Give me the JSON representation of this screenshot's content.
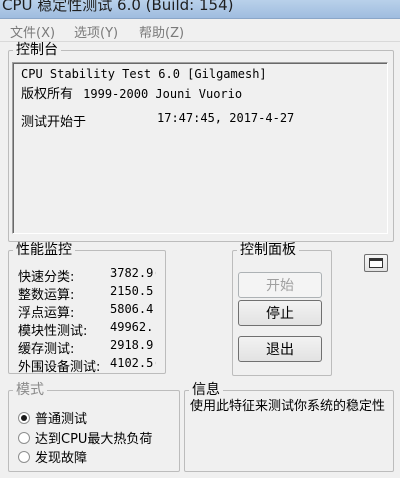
{
  "window": {
    "title": "CPU 稳定性测试 6.0 (Build: 154)"
  },
  "menu": {
    "items": [
      "文件(X)",
      "选项(Y)",
      "帮助(Z)"
    ]
  },
  "console": {
    "title": "控制台",
    "line1": "CPU Stability Test 6.0 [Gilgamesh]",
    "line2_label": "版权所有",
    "line2_value": "1999-2000 Jouni Vuorio",
    "start_label": "测试开始于",
    "start_value": "17:47:45, 2017-4-27"
  },
  "monitor": {
    "title": "性能监控",
    "rows": [
      {
        "label": "快速分类:",
        "value": "3782.9("
      },
      {
        "label": "整数运算:",
        "value": "2150.5·"
      },
      {
        "label": "浮点运算:",
        "value": "5806.4!"
      },
      {
        "label": "模块性测试:",
        "value": "49962.!"
      },
      {
        "label": "缓存测试:",
        "value": "2918.9:"
      },
      {
        "label": "外围设备测试:",
        "value": "4102.5("
      }
    ]
  },
  "control": {
    "title": "控制面板",
    "start_label": "开始",
    "stop_label": "停止",
    "exit_label": "退出"
  },
  "mode": {
    "title": "模式",
    "options": [
      "普通测试",
      "达到CPU最大热负荷",
      "发现故障"
    ],
    "selected_index": 0
  },
  "info": {
    "title": "信息",
    "text": "使用此特征来测试你系统的稳定性"
  }
}
